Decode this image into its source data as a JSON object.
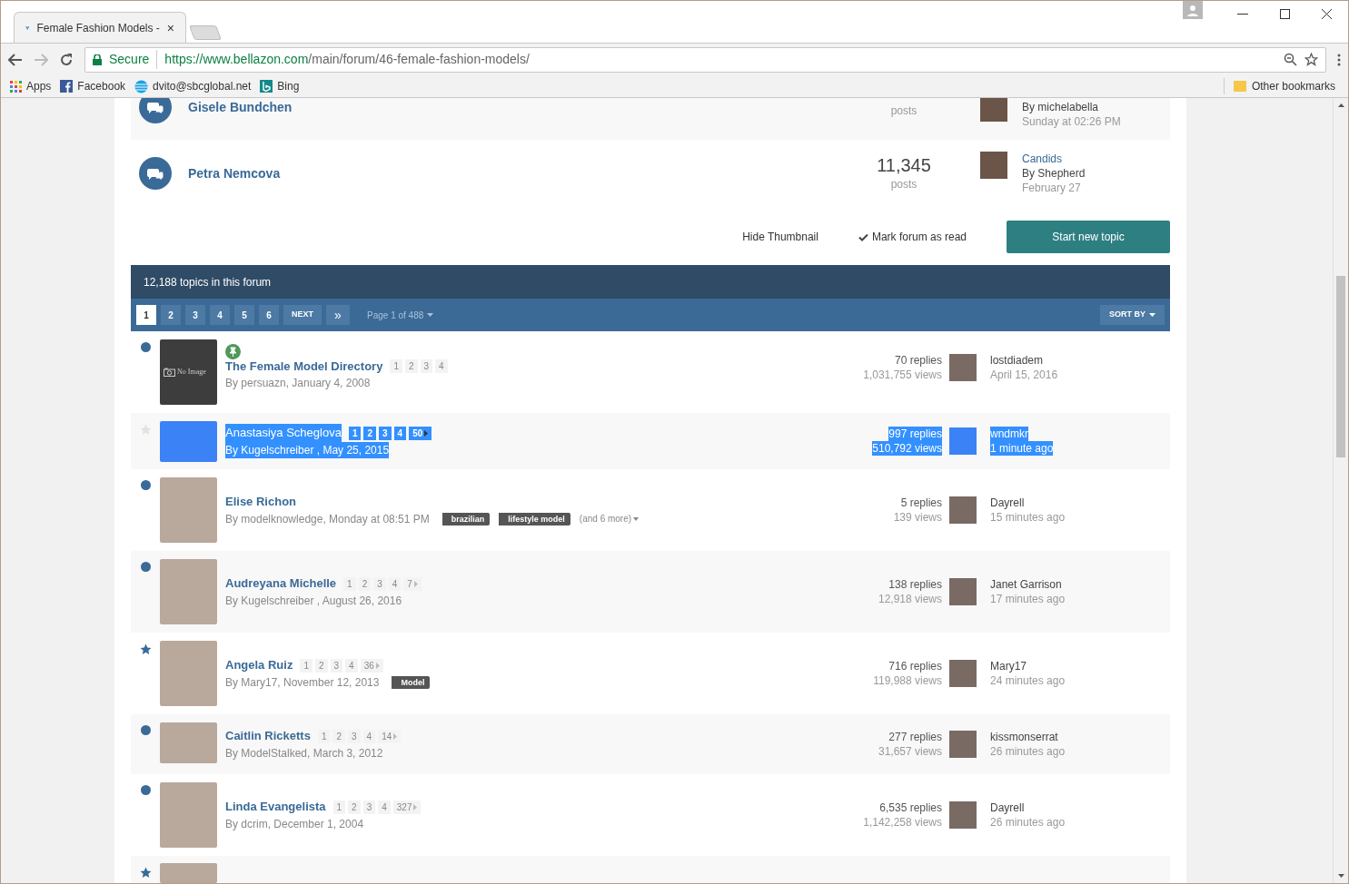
{
  "browser": {
    "tab": {
      "title": "Female Fashion Models -",
      "close": "×"
    },
    "secure_label": "Secure",
    "url_host": "https://www.bellazon.com",
    "url_path": "/main/forum/46-female-fashion-models/",
    "bookmarks": [
      {
        "kind": "apps",
        "label": "Apps"
      },
      {
        "kind": "facebook",
        "label": "Facebook"
      },
      {
        "kind": "att",
        "label": "dvito@sbcglobal.net"
      },
      {
        "kind": "bing",
        "label": "Bing"
      }
    ],
    "other_bookmarks": "Other bookmarks"
  },
  "forums": [
    {
      "name": "Gisele Bundchen",
      "count_label": "posts",
      "last_by": "By michelabella",
      "last_time": "Sunday at 02:26 PM"
    },
    {
      "name": "Petra Nemcova",
      "count": "11,345",
      "count_label": "posts",
      "last_title": "Candids",
      "last_by": "By Shepherd",
      "last_time": "February 27"
    }
  ],
  "actions": {
    "hide_thumbnail": "Hide Thumbnail",
    "mark_read": "Mark forum as read",
    "start_topic": "Start new topic"
  },
  "topics_header": "12,188 topics in this forum",
  "pagination": {
    "pages": [
      {
        "label": "1",
        "selected": true
      },
      {
        "label": "2",
        "selected": false
      },
      {
        "label": "3",
        "selected": false
      },
      {
        "label": "4",
        "selected": false
      },
      {
        "label": "5",
        "selected": false
      },
      {
        "label": "6",
        "selected": false
      }
    ],
    "next": "NEXT",
    "last": "»",
    "page_info": "Page 1 of 488",
    "sort": "SORT BY"
  },
  "topics": [
    {
      "unread": true,
      "starred": false,
      "has_thumbnail": false,
      "thumb_text": "No Image",
      "pinned": true,
      "selected": false,
      "title": "The Female Model Directory",
      "pages": [
        "1",
        "2",
        "3",
        "4"
      ],
      "more_pages": false,
      "byline": "By persuazn, January 4, 2008",
      "replies": "70 replies",
      "views": "1,031,755 views",
      "last_user": "lostdiadem",
      "last_time": "April 15, 2016"
    },
    {
      "unread": false,
      "starred": false,
      "has_thumbnail": true,
      "pinned": false,
      "selected": true,
      "title": "Anastasiya Scheglova",
      "pages": [
        "1",
        "2",
        "3",
        "4",
        "50"
      ],
      "more_pages": true,
      "byline": "By Kugelschreiber , May 25, 2015",
      "replies": "997 replies",
      "views": "510,792 views",
      "last_user": "wndmkr",
      "last_time": "1 minute ago"
    },
    {
      "unread": true,
      "starred": false,
      "has_thumbnail": true,
      "pinned": false,
      "selected": false,
      "title": "Elise Richon",
      "byline": "By modelknowledge, Monday at 08:51 PM",
      "tags": [
        "brazilian",
        "lifestyle model"
      ],
      "tags_more": "(and 6 more)",
      "replies": "5 replies",
      "views": "139 views",
      "last_user": "Dayrell",
      "last_time": "15 minutes ago"
    },
    {
      "unread": true,
      "starred": false,
      "has_thumbnail": true,
      "pinned": false,
      "selected": false,
      "title": "Audreyana Michelle",
      "pages": [
        "1",
        "2",
        "3",
        "4",
        "7"
      ],
      "more_pages": true,
      "byline": "By Kugelschreiber , August 26, 2016",
      "replies": "138 replies",
      "views": "12,918 views",
      "last_user": "Janet Garrison",
      "last_time": "17 minutes ago"
    },
    {
      "starred": true,
      "has_thumbnail": true,
      "pinned": false,
      "selected": false,
      "title": "Angela Ruiz",
      "pages": [
        "1",
        "2",
        "3",
        "4",
        "36"
      ],
      "more_pages": true,
      "byline": "By Mary17, November 12, 2013",
      "tags": [
        "Model"
      ],
      "replies": "716 replies",
      "views": "119,988 views",
      "last_user": "Mary17",
      "last_time": "24 minutes ago"
    },
    {
      "unread": true,
      "starred": false,
      "has_thumbnail": true,
      "pinned": false,
      "selected": false,
      "title": "Caitlin Ricketts",
      "pages": [
        "1",
        "2",
        "3",
        "4",
        "14"
      ],
      "more_pages": true,
      "byline": "By ModelStalked, March 3, 2012",
      "replies": "277 replies",
      "views": "31,657 views",
      "last_user": "kissmonserrat",
      "last_time": "26 minutes ago"
    },
    {
      "unread": true,
      "starred": false,
      "has_thumbnail": true,
      "pinned": false,
      "selected": false,
      "title": "Linda Evangelista",
      "pages": [
        "1",
        "2",
        "3",
        "4",
        "327"
      ],
      "more_pages": true,
      "byline": "By dcrim, December 1, 2004",
      "replies": "6,535 replies",
      "views": "1,142,258 views",
      "last_user": "Dayrell",
      "last_time": "26 minutes ago"
    },
    {
      "starred": true,
      "has_thumbnail": true,
      "pinned": false,
      "selected": false
    }
  ]
}
